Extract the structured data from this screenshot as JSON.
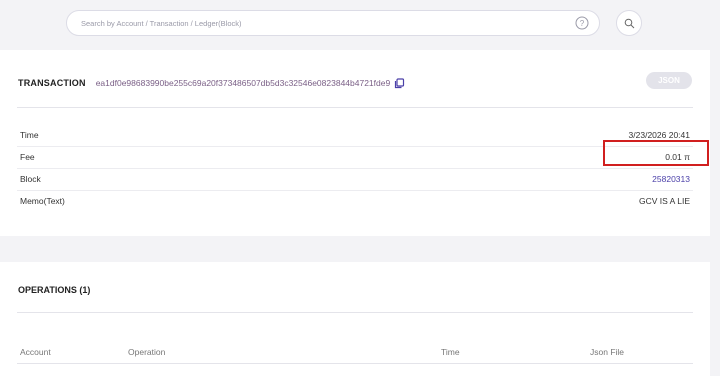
{
  "search": {
    "placeholder": "Search by Account / Transaction / Ledger(Block)"
  },
  "icons": {
    "help": "help-circle-icon",
    "search": "search-icon",
    "copy": "copy-icon"
  },
  "colors": {
    "accent": "#4a3fa8",
    "highlight": "#d11f1f",
    "hash": "#7a5f86"
  },
  "transaction": {
    "title": "TRANSACTION",
    "hash": "ea1df0e98683990be255c69a20f373486507db5d3c32546e0823844b4721fde9",
    "json_label": "JSON",
    "rows": [
      {
        "label": "Time",
        "value": "3/23/2026 20:41"
      },
      {
        "label": "Fee",
        "value": "0.01 π"
      },
      {
        "label": "Block",
        "value": "25820313"
      },
      {
        "label": "Memo(Text)",
        "value": "GCV IS A LIE"
      }
    ]
  },
  "operations": {
    "title": "OPERATIONS (1)",
    "columns": [
      "Account",
      "Operation",
      "Time",
      "Json File"
    ]
  }
}
